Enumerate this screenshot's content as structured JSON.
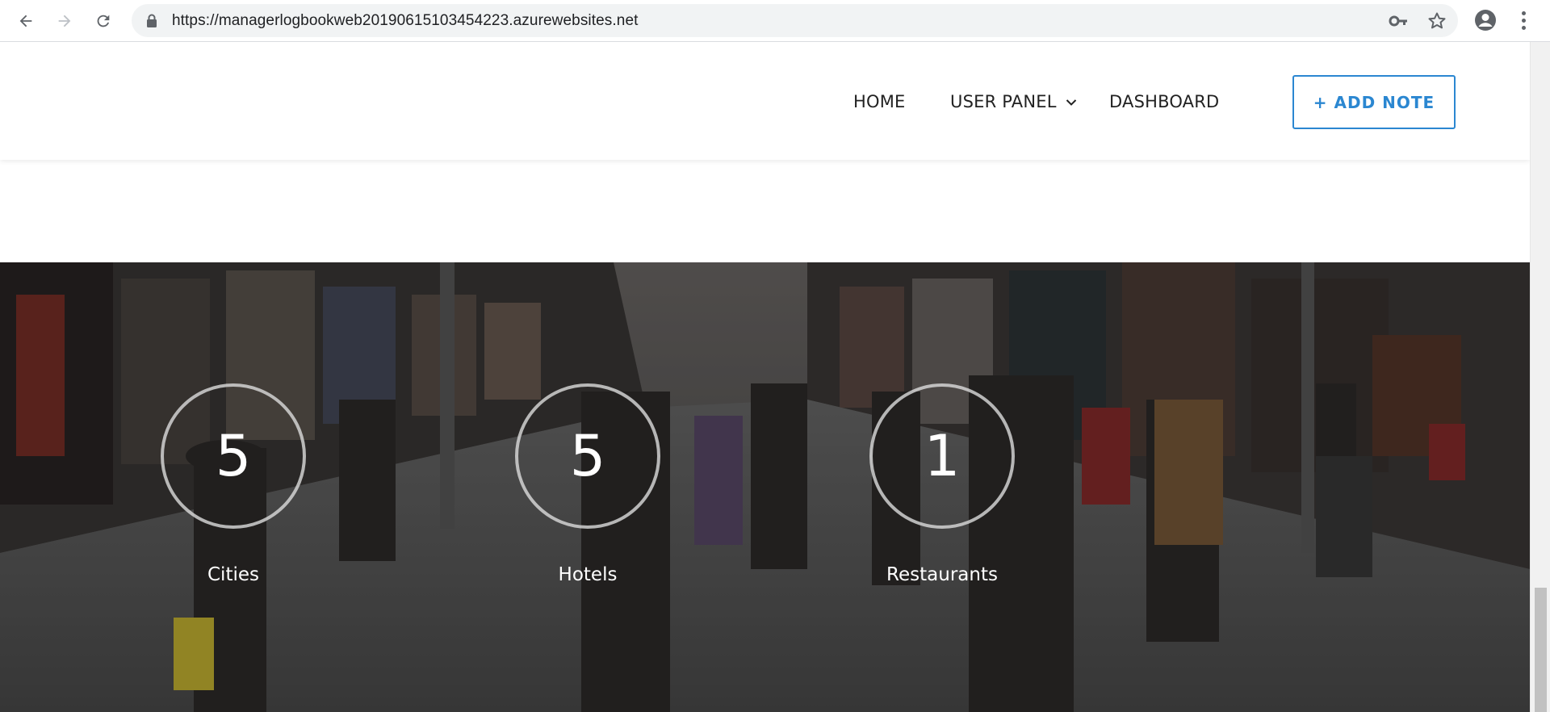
{
  "browser": {
    "url": "https://managerlogbookweb20190615103454223.azurewebsites.net",
    "icons": [
      "back-icon",
      "forward-icon",
      "reload-icon",
      "lock-icon",
      "key-icon",
      "star-icon",
      "profile-icon",
      "menu-icon"
    ]
  },
  "header": {
    "nav": {
      "home": "HOME",
      "user_panel": "USER PANEL",
      "dashboard": "DASHBOARD"
    },
    "add_note": "+ ADD NOTE"
  },
  "stats": [
    {
      "value": "5",
      "label": "Cities"
    },
    {
      "value": "5",
      "label": "Hotels"
    },
    {
      "value": "1",
      "label": "Restaurants"
    }
  ],
  "colors": {
    "accent": "#2b87d1",
    "nav_text": "#222222",
    "stat_text": "#ffffff"
  }
}
